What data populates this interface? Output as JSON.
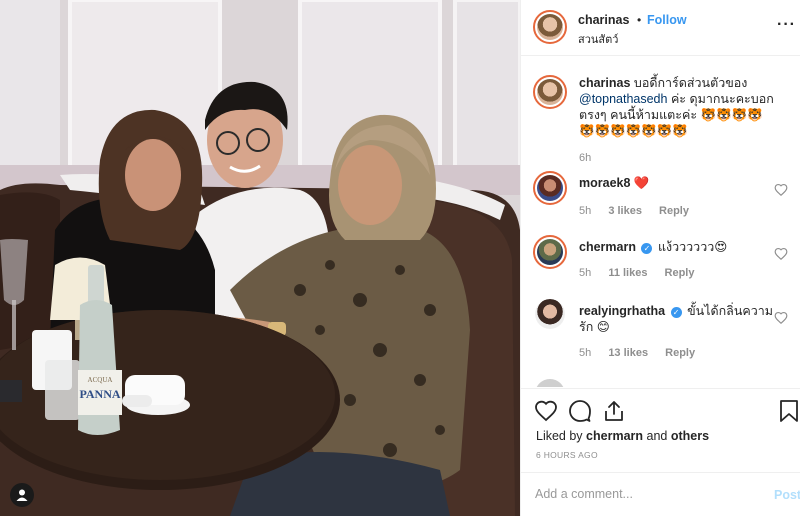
{
  "header": {
    "username": "charinas",
    "separator": "•",
    "follow_label": "Follow",
    "location": "สวนสัตว์",
    "more_label": "···"
  },
  "caption": {
    "username": "charinas",
    "text_before": "บอดี้การ์ดส่วนตัวของ",
    "mention": "@topnathasedh",
    "text_after": "ค่ะ ดุมากนะคะบอกตรงๆ คนนี้ห้ามแตะค่ะ 🐯🐯🐯🐯🐯🐯🐯🐯🐯🐯🐯",
    "time": "6h"
  },
  "comments": [
    {
      "username": "moraek8",
      "verified": false,
      "text": "❤️",
      "time": "5h",
      "likes": "3 likes",
      "reply": "Reply"
    },
    {
      "username": "chermarn",
      "verified": true,
      "text": "แง้วววววว😍",
      "time": "5h",
      "likes": "11 likes",
      "reply": "Reply"
    },
    {
      "username": "realyingrhatha",
      "verified": true,
      "text": "ขั้นได้กลิ่นความรัก 😊",
      "time": "5h",
      "likes": "13 likes",
      "reply": "Reply"
    }
  ],
  "likes_line": {
    "prefix": "Liked by",
    "user": "chermarn",
    "joiner": "and",
    "others": "others"
  },
  "timestamp": "6 HOURS AGO",
  "add_comment": {
    "placeholder": "Add a comment...",
    "post_label": "Post"
  },
  "photo": {
    "bottle_brand": "PANNA",
    "bottle_small": "ACQUA",
    "description_icons": [
      "user-tag-icon"
    ]
  },
  "colors": {
    "link": "#3897f0",
    "post_disabled": "#b2dffc",
    "meta": "#8e8e8e",
    "text": "#262626"
  },
  "icons": {
    "like": "heart-outline-icon",
    "comment": "speech-bubble-icon",
    "share": "share-upload-icon",
    "save": "bookmark-icon",
    "comment_like": "small-heart-icon"
  }
}
